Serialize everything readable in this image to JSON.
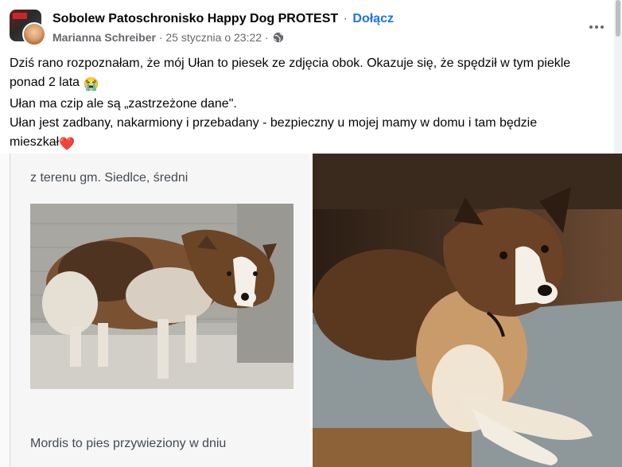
{
  "header": {
    "group_name": "Sobolew Patoschronisko Happy Dog PROTEST",
    "separator": "·",
    "join_label": "Dołącz",
    "author": "Marianna Schreiber",
    "date": "25 stycznia o 23:22",
    "meta_separator": "·",
    "privacy_icon": "globe-icon",
    "more_icon": "more-options-icon"
  },
  "post": {
    "line1": "Dziś rano rozpoznałam, że mój Ułan to piesek ze zdjęcia obok. Okazuje się, że spędził w tym piekle",
    "line2": "ponad 2 lata",
    "line2_emoji": "😭",
    "line3": "Ułan ma czip ale są „zastrzeżone dane\".",
    "line4": "Ułan jest zadbany, nakarmiony i przebadany - bezpieczny u mojej mamy w domu i tam będzie",
    "line5": "mieszkał",
    "line5_emoji": "❤️"
  },
  "photos": {
    "left_caption_top": "z terenu gm. Siedlce, średni",
    "left_caption_bottom": "Mordis to pies przywieziony w dniu"
  },
  "colors": {
    "link": "#1b74e4",
    "secondary_text": "#65676b",
    "primary_text": "#050505"
  }
}
